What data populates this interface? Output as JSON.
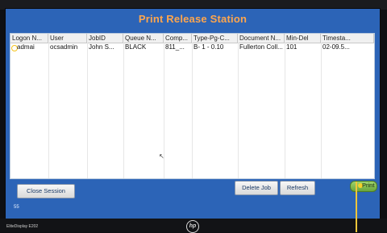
{
  "window": {
    "title": "Print Release Station"
  },
  "table": {
    "columns": [
      "Logon N...",
      "User",
      "JobID",
      "Queue N...",
      "Comp...",
      "Type-Pg-C...",
      "Document N...",
      "Min-Del",
      "Timesta..."
    ],
    "rows": [
      [
        "admai",
        "ocsadmin",
        "John S...",
        "BLACK",
        "811_...",
        "B- 1 - 0.10",
        "Fullerton Coll...",
        "101",
        "02-09.5..."
      ]
    ]
  },
  "buttons": {
    "close_session": "Close Session",
    "delete_job": "Delete Job",
    "refresh": "Refresh",
    "print": "Print"
  },
  "status_text": "55",
  "monitor": {
    "brand_text": "EliteDisplay E202",
    "logo_text": "hp"
  }
}
